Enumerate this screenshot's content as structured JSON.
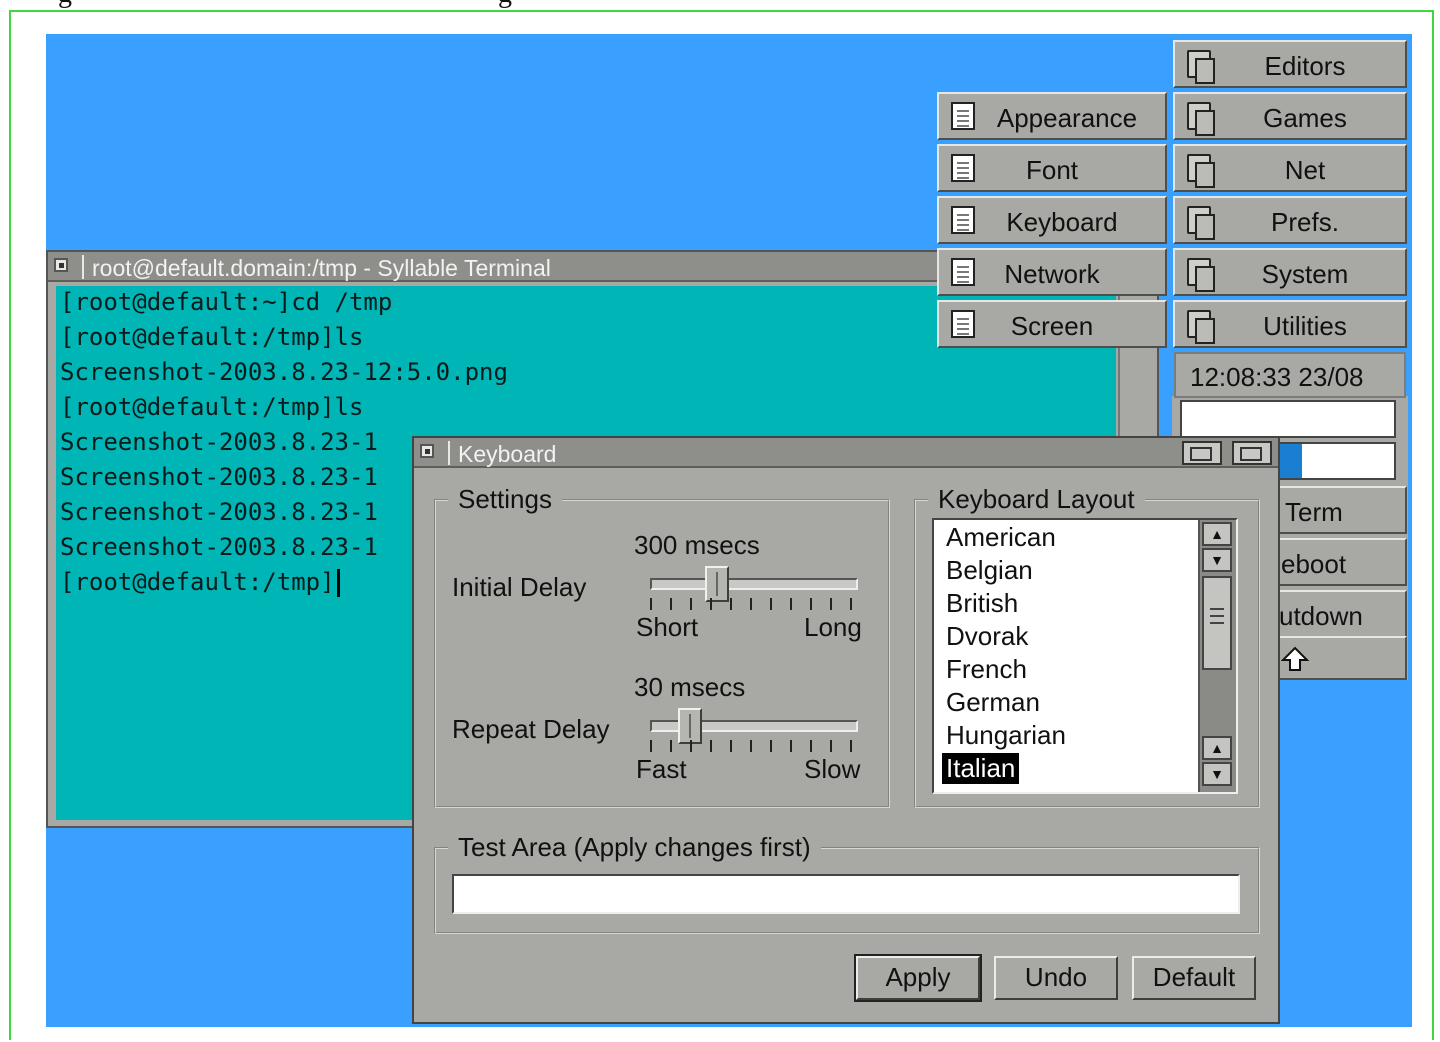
{
  "terminal": {
    "title": "root@default.domain:/tmp - Syllable Terminal",
    "lines": [
      "[root@default:~]cd /tmp",
      "[root@default:/tmp]ls",
      "Screenshot-2003.8.23-12:5.0.png",
      "[root@default:/tmp]ls",
      "Screenshot-2003.8.23-1",
      "Screenshot-2003.8.23-1",
      "Screenshot-2003.8.23-1",
      "Screenshot-2003.8.23-1",
      "[root@default:/tmp]"
    ]
  },
  "prefs_menu": {
    "items": [
      {
        "label": "Appearance",
        "icon": "document-icon"
      },
      {
        "label": "Font",
        "icon": "document-icon"
      },
      {
        "label": "Keyboard",
        "icon": "document-icon"
      },
      {
        "label": "Network",
        "icon": "document-icon"
      },
      {
        "label": "Screen",
        "icon": "document-icon"
      }
    ]
  },
  "main_menu": {
    "items": [
      {
        "label": "Editors",
        "icon": "folder-icon"
      },
      {
        "label": "Games",
        "icon": "folder-icon"
      },
      {
        "label": "Net",
        "icon": "folder-icon"
      },
      {
        "label": "Prefs.",
        "icon": "folder-icon"
      },
      {
        "label": "System",
        "icon": "folder-icon"
      },
      {
        "label": "Utilities",
        "icon": "folder-icon"
      }
    ]
  },
  "dock": {
    "clock": "12:08:33 23/08",
    "partial_items": [
      "Term",
      "eboot",
      "utdown"
    ]
  },
  "keyboard_dialog": {
    "title": "Keyboard",
    "settings": {
      "legend": "Settings",
      "initial_delay": {
        "label": "Initial Delay",
        "value_text": "300 msecs",
        "min_label": "Short",
        "max_label": "Long",
        "level": 0.3
      },
      "repeat_delay": {
        "label": "Repeat Delay",
        "value_text": "30 msecs",
        "min_label": "Fast",
        "max_label": "Slow",
        "level": 0.15
      }
    },
    "layout": {
      "legend": "Keyboard Layout",
      "items": [
        "American",
        "Belgian",
        "British",
        "Dvorak",
        "French",
        "German",
        "Hungarian",
        "Italian"
      ],
      "selected": "Italian"
    },
    "test_area": {
      "legend": "Test Area (Apply changes first)",
      "value": ""
    },
    "buttons": {
      "apply": "Apply",
      "undo": "Undo",
      "default": "Default"
    }
  },
  "colors": {
    "desktop": "#3aa0ff",
    "terminal_bg": "#00b5b5",
    "window_bg": "#a8a9a4"
  }
}
